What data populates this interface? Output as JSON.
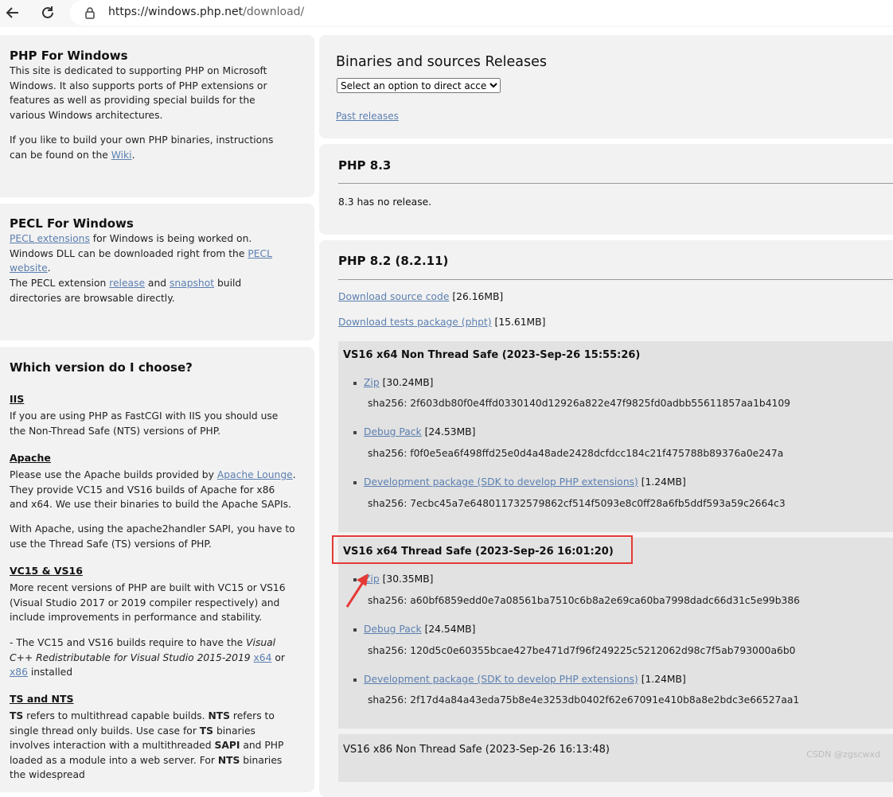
{
  "browser": {
    "url_host": "https://windows.php.net",
    "url_path": "/download/"
  },
  "sidebar": {
    "php_for_windows": {
      "title": "PHP For Windows",
      "p1": "This site is dedicated to supporting PHP on Microsoft Windows. It also supports ports of PHP extensions or features as well as providing special builds for the various Windows architectures.",
      "p2_pre": "If you like to build your own PHP binaries, instructions can be found on the ",
      "p2_link": "Wiki",
      "p2_post": "."
    },
    "pecl": {
      "title": "PECL For Windows",
      "link1": "PECL extensions",
      "t1": " for Windows is being worked on. Windows DLL can be downloaded right from the ",
      "link2": "PECL website",
      "t2": ".",
      "t3": "The PECL extension ",
      "link3": "release",
      "t4": " and ",
      "link4": "snapshot",
      "t5": " build directories are browsable directly."
    },
    "which": {
      "title": "Which version do I choose?",
      "iis_h": "IIS",
      "iis_p": "If you are using PHP as FastCGI with IIS you should use the Non-Thread Safe (NTS) versions of PHP.",
      "apache_h": "Apache",
      "apache_p1_pre": "Please use the Apache builds provided by ",
      "apache_link": "Apache Lounge",
      "apache_p1_post": ". They provide VC15 and VS16 builds of Apache for x86 and x64. We use their binaries to build the Apache SAPIs.",
      "apache_p2": "With Apache, using the apache2handler SAPI, you have to use the Thread Safe (TS) versions of PHP.",
      "vc_h": "VC15 & VS16",
      "vc_p1": "More recent versions of PHP are built with VC15 or VS16 (Visual Studio 2017 or 2019 compiler respectively) and include improvements in performance and stability.",
      "vc_p2_pre": "- The VC15 and VS16 builds require to have the ",
      "vc_p2_em": "Visual C++ Redistributable for Visual Studio 2015-2019",
      "vc_p2_link1": "x64",
      "vc_p2_or": " or ",
      "vc_p2_link2": "x86",
      "vc_p2_post": " installed",
      "ts_h": "TS and NTS",
      "ts_b1": "TS",
      "ts_t1": " refers to multithread capable builds. ",
      "ts_b2": "NTS",
      "ts_t2": " refers to single thread only builds. Use case for ",
      "ts_b3": "TS",
      "ts_t3": " binaries involves interaction with a multithreaded ",
      "ts_b4": "SAPI",
      "ts_t4": " and PHP loaded as a module into a web server. For ",
      "ts_b5": "NTS",
      "ts_t5": " binaries the widespread"
    }
  },
  "releases": {
    "title": "Binaries and sources Releases",
    "select": "Select an option to direct access...",
    "past": "Past releases"
  },
  "php83": {
    "title": "PHP 8.3",
    "text": "8.3 has no release."
  },
  "php82": {
    "title": "PHP 8.2 (8.2.11)",
    "src_link": "Download source code",
    "src_size": "[26.16MB]",
    "tests_link": "Download tests package (phpt)",
    "tests_size": "[15.61MB]",
    "builds": [
      {
        "title": "VS16 x64 Non Thread Safe (2023-Sep-26 15:55:26)",
        "items": [
          {
            "link": "Zip",
            "size": "[30.24MB]",
            "sha": "sha256: 2f603db80f0e4ffd0330140d12926a822e47f9825fd0adbb55611857aa1b4109"
          },
          {
            "link": "Debug Pack",
            "size": "[24.53MB]",
            "sha": "sha256: f0f0e5ea6f498ffd25e0d4a48ade2428dcfdcc184c21f475788b89376a0e247a"
          },
          {
            "link": "Development package (SDK to develop PHP extensions)",
            "size": "[1.24MB]",
            "sha": "sha256: 7ecbc45a7e648011732579862cf514f5093e8c0ff28a6fb5ddf593a59c2664c3"
          }
        ]
      },
      {
        "title": "VS16 x64 Thread Safe (2023-Sep-26 16:01:20)",
        "items": [
          {
            "link": "Zip",
            "size": "[30.35MB]",
            "sha": "sha256: a60bf6859edd0e7a08561ba7510c6b8a2e69ca60ba7998dadc66d31c5e99b386"
          },
          {
            "link": "Debug Pack",
            "size": "[24.54MB]",
            "sha": "sha256: 120d5c0e60355bcae427be471d7f96f249225c5212062d98c7f5ab793000a6b0"
          },
          {
            "link": "Development package (SDK to develop PHP extensions)",
            "size": "[1.24MB]",
            "sha": "sha256: 2f17d4a84a43eda75b8e4e3253db0402f62e67091e410b8a8e2bdc3e66527aa1"
          }
        ]
      },
      {
        "title": "VS16 x86 Non Thread Safe (2023-Sep-26 16:13:48)"
      }
    ]
  },
  "watermark": "CSDN @zgscwxd",
  "colors": {
    "link": "#5b7fb0",
    "highlight": "#e53935",
    "panel": "#f2f2f2",
    "block": "#e2e2e2"
  }
}
